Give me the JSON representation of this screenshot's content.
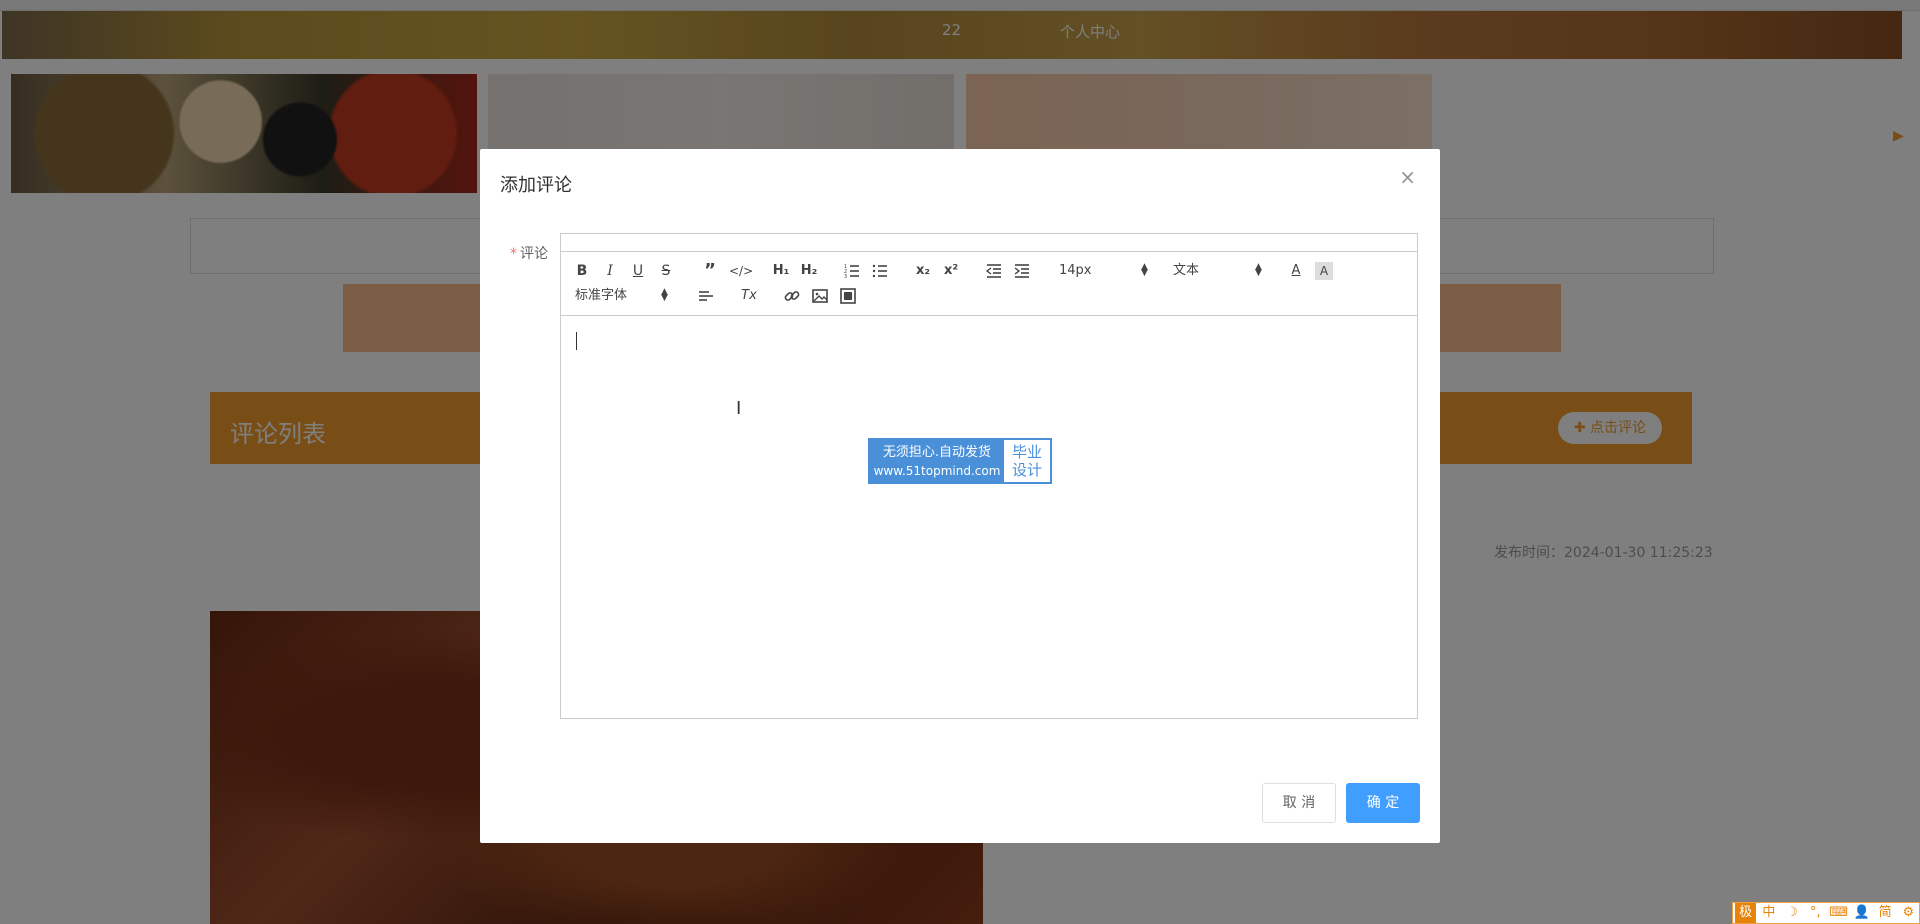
{
  "nav": {
    "item_1": "22",
    "item_2": "个人中心"
  },
  "comments": {
    "header_title": "评论列表",
    "add_button": "点击评论",
    "publish_time": "发布时间：2024-01-30 11:25:23"
  },
  "dialog": {
    "title": "添加评论",
    "close_icon": "×",
    "required_mark": "*",
    "field_label": "评论",
    "editor": {
      "font_size": "14px",
      "header_select": "文本",
      "font_family": "标准字体",
      "tool_bold": "B",
      "tool_italic": "I",
      "tool_underline": "U",
      "tool_strike": "S",
      "tool_h1": "H₁",
      "tool_h2": "H₂",
      "tool_sub": "x₂",
      "tool_sup": "x²",
      "tool_clean": "Tx"
    },
    "cancel": "取 消",
    "confirm": "确 定"
  },
  "watermark": {
    "line_1": "无须担心.自动发货",
    "line_2": "www.51topmind.com",
    "side_1": "毕业",
    "side_2": "设计"
  },
  "ime": [
    "中",
    "☽",
    "°,",
    "⌨",
    "👤",
    "简",
    "⚙"
  ],
  "colors": {
    "accent": "#f09a2c",
    "primary": "#409eff",
    "required": "#f56c6c"
  }
}
